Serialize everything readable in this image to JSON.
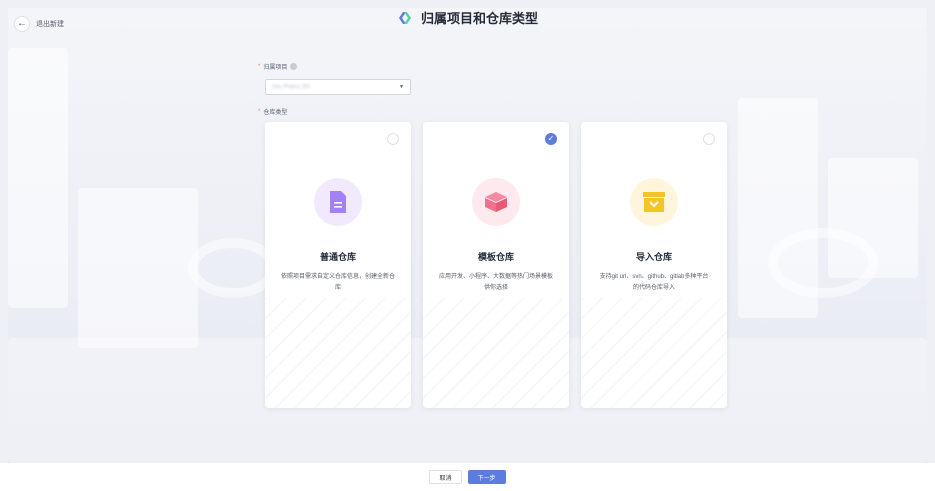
{
  "header": {
    "back_label": "退出新建",
    "title": "归属项目和仓库类型"
  },
  "form": {
    "project_label": "归属项目",
    "project_value": "Use_Project_001",
    "repo_type_label": "仓库类型"
  },
  "cards": [
    {
      "name": "普通仓库",
      "desc": "依照项目需求自定义仓库信息，创建全新仓库",
      "icon": "document-icon",
      "selected": false,
      "icon_bg": "#f1e9fd",
      "icon_color": "#a281f5"
    },
    {
      "name": "模板仓库",
      "desc": "应用开发、小程序、大数据等热门场景模板供你选择",
      "icon": "box-icon",
      "selected": true,
      "icon_bg": "#fde9ee",
      "icon_color": "#f0718d"
    },
    {
      "name": "导入仓库",
      "desc": "支持git url、svn、github、gitlab多种平台的代码仓库导入",
      "icon": "import-icon",
      "selected": false,
      "icon_bg": "#fff5dc",
      "icon_color": "#f5c428"
    }
  ],
  "footer": {
    "cancel_label": "取消",
    "next_label": "下一步"
  },
  "colors": {
    "accent": "#5e7ce0",
    "required": "#f66f6a"
  }
}
